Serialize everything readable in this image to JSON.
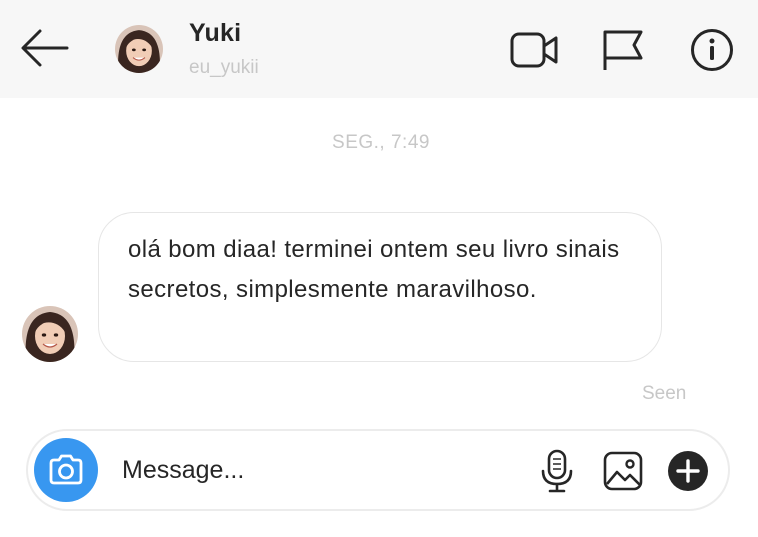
{
  "header": {
    "display_name": "Yuki",
    "username": "eu_yukii",
    "icons": {
      "back": "arrow-left-icon",
      "video": "video-camera-icon",
      "flag": "flag-icon",
      "info": "info-icon"
    }
  },
  "thread": {
    "timestamp": "SEG., 7:49",
    "messages": [
      {
        "sender": "Yuki",
        "text": "olá bom diaa! terminei ontem seu livro sinais secretos, simplesmente maravilhoso."
      }
    ],
    "seen_label": "Seen"
  },
  "composer": {
    "placeholder": "Message...",
    "value": "",
    "icons": {
      "camera": "camera-icon",
      "mic": "microphone-icon",
      "gallery": "image-gallery-icon",
      "more": "plus-icon"
    }
  },
  "colors": {
    "header_bg": "#f7f7f7",
    "camera_button": "#3897f0",
    "muted_text": "#c7c7c7",
    "primary_text": "#262626"
  }
}
